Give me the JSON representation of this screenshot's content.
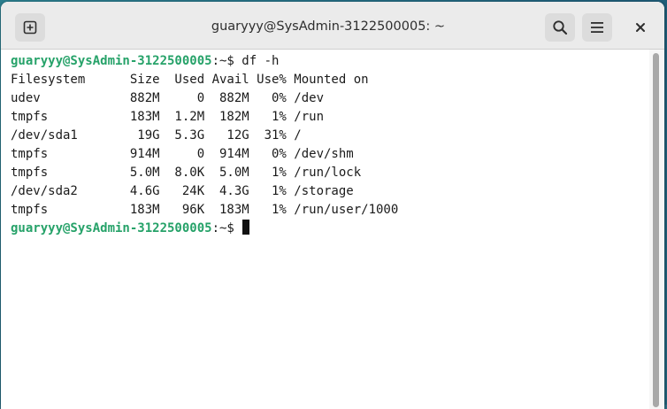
{
  "window": {
    "title": "guaryyy@SysAdmin-3122500005: ~"
  },
  "header": {
    "buttons": {
      "new_tab_icon": "new-tab-icon",
      "search_icon": "search-icon",
      "menu_icon": "hamburger-menu-icon",
      "close_icon": "close-icon"
    }
  },
  "terminal": {
    "prompt_user_host": "guaryyy@SysAdmin-3122500005",
    "prompt_suffix": ":~$ ",
    "command": "df -h",
    "df_header": "Filesystem      Size  Used Avail Use% Mounted on",
    "df_rows": [
      "udev            882M     0  882M   0% /dev",
      "tmpfs           183M  1.2M  182M   1% /run",
      "/dev/sda1        19G  5.3G   12G  31% /",
      "tmpfs           914M     0  914M   0% /dev/shm",
      "tmpfs           5.0M  8.0K  5.0M   1% /run/lock",
      "/dev/sda2       4.6G   24K  4.3G   1% /storage",
      "tmpfs           183M   96K  183M   1% /run/user/1000"
    ],
    "colors": {
      "prompt_user": "#26a269",
      "text": "#1b1b1b",
      "background": "#ffffff"
    }
  }
}
